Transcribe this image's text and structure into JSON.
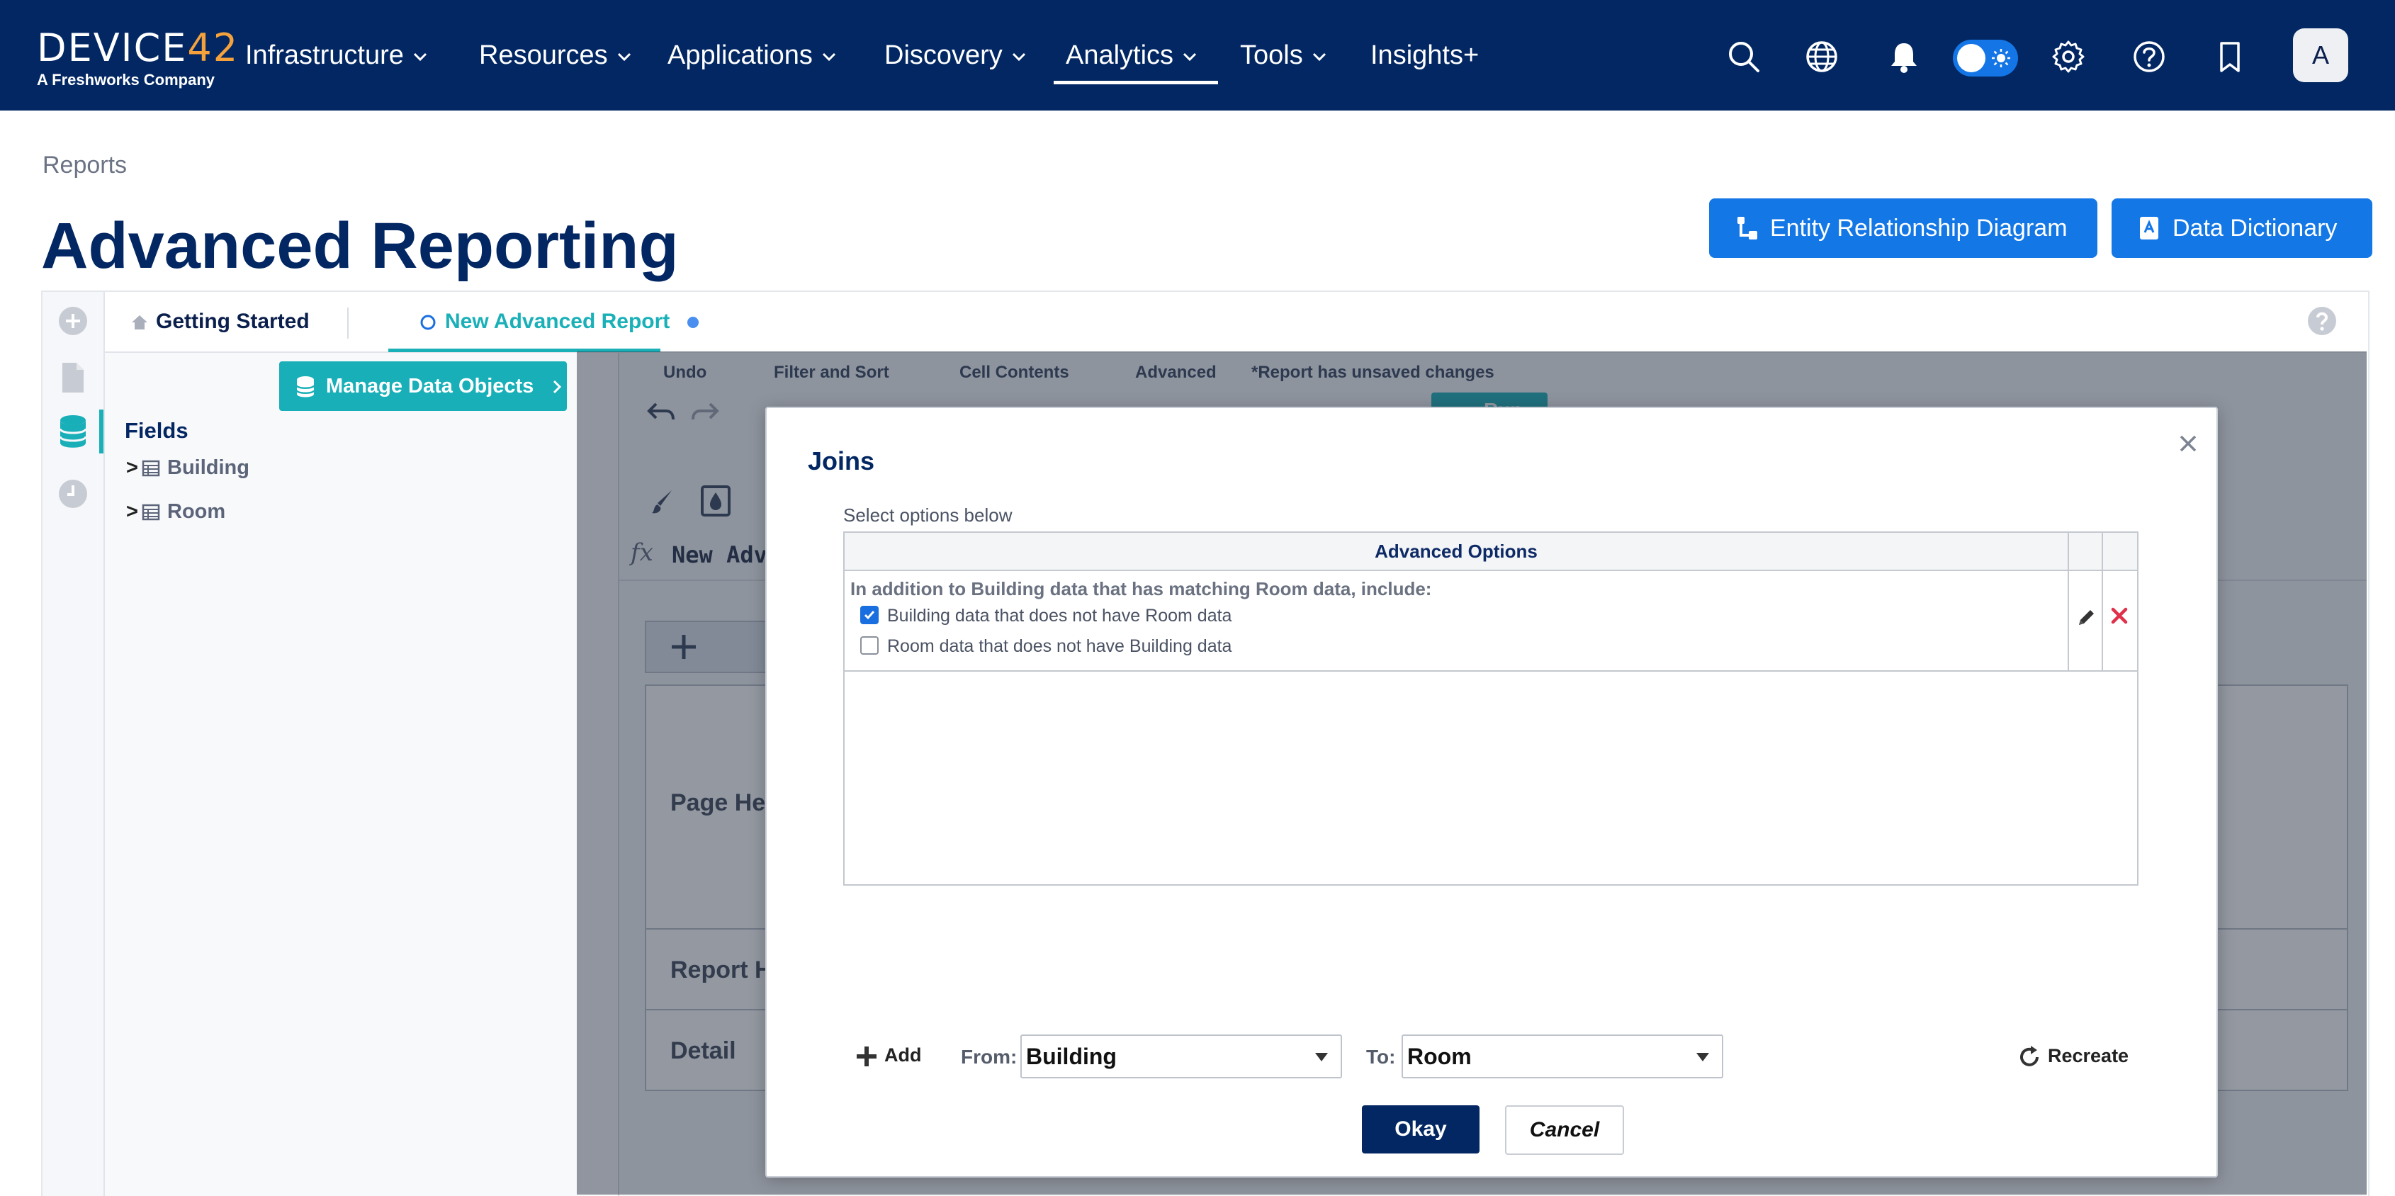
{
  "brand": {
    "logo_text_main": "DEVICE",
    "logo_text_accent": "42",
    "logo_sub": "A Freshworks Company"
  },
  "nav": {
    "items": [
      {
        "label": "Infrastructure",
        "has_dropdown": true
      },
      {
        "label": "Resources",
        "has_dropdown": true
      },
      {
        "label": "Applications",
        "has_dropdown": true
      },
      {
        "label": "Discovery",
        "has_dropdown": true
      },
      {
        "label": "Analytics",
        "has_dropdown": true,
        "active": true
      },
      {
        "label": "Tools",
        "has_dropdown": true
      },
      {
        "label": "Insights+",
        "has_dropdown": false
      }
    ],
    "icons": [
      "search-icon",
      "globe-icon",
      "bell-icon",
      "theme-toggle",
      "gear-icon",
      "help-icon",
      "bookmark-icon"
    ],
    "avatar_initial": "A"
  },
  "header": {
    "breadcrumb": "Reports",
    "title": "Advanced Reporting",
    "buttons": {
      "erd": "Entity Relationship Diagram",
      "data_dictionary": "Data Dictionary"
    }
  },
  "tabs": {
    "getting_started": "Getting Started",
    "new_report": "New Advanced Report"
  },
  "left_panel": {
    "manage_button": "Manage Data Objects",
    "fields_title": "Fields",
    "tree": [
      "Building",
      "Room"
    ]
  },
  "workspace": {
    "toolbar_groups": [
      "Undo",
      "Filter and Sort",
      "Cell Contents",
      "Advanced",
      "*Report has unsaved changes"
    ],
    "run_label": "Run",
    "formula_text": "New Adv",
    "sections": [
      "Page Hea",
      "Report H",
      "Detail"
    ]
  },
  "modal": {
    "title": "Joins",
    "subtitle": "Select options below",
    "grid_header": "Advanced Options",
    "row_heading": "In addition to Building data that has matching Room data, include:",
    "options": [
      {
        "label": "Building data that does not have Room data",
        "checked": true
      },
      {
        "label": "Room data that does not have Building data",
        "checked": false
      }
    ],
    "add_label": "Add",
    "from_label": "From:",
    "from_value": "Building",
    "to_label": "To:",
    "to_value": "Room",
    "recreate_label": "Recreate",
    "okay_label": "Okay",
    "cancel_label": "Cancel"
  },
  "colors": {
    "nav_bg": "#022763",
    "accent_teal": "#19afb8",
    "primary_blue": "#1477e6",
    "logo_accent": "#f5a23c",
    "delete_red": "#e0304a"
  }
}
